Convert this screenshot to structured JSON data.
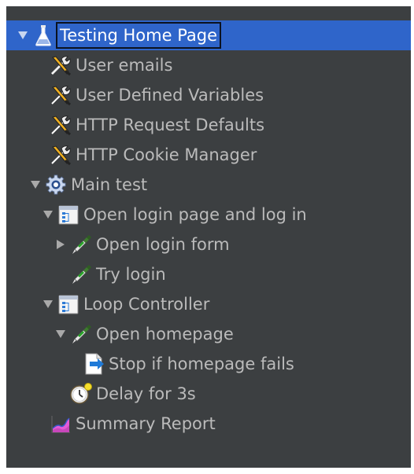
{
  "tree": {
    "items": [
      {
        "label": "Testing Home Page",
        "icon": "test-plan-icon",
        "expanded": true,
        "selected": true
      },
      {
        "label": "User emails",
        "icon": "config-element-icon"
      },
      {
        "label": "User Defined Variables",
        "icon": "config-element-icon"
      },
      {
        "label": "HTTP Request Defaults",
        "icon": "config-element-icon"
      },
      {
        "label": "HTTP Cookie Manager",
        "icon": "config-element-icon"
      },
      {
        "label": "Main test",
        "icon": "thread-group-icon",
        "expanded": true
      },
      {
        "label": "Open login page and log in",
        "icon": "controller-icon",
        "expanded": true
      },
      {
        "label": "Open login form",
        "icon": "sampler-icon",
        "expanded": false
      },
      {
        "label": "Try login",
        "icon": "sampler-icon"
      },
      {
        "label": "Loop Controller",
        "icon": "controller-icon",
        "expanded": true
      },
      {
        "label": "Open homepage",
        "icon": "sampler-icon",
        "expanded": true
      },
      {
        "label": "Stop if homepage fails",
        "icon": "assertion-icon"
      },
      {
        "label": "Delay for 3s",
        "icon": "timer-icon"
      },
      {
        "label": "Summary Report",
        "icon": "listener-icon"
      }
    ]
  },
  "colors": {
    "background": "#3c3f41",
    "selection": "#2f65ca",
    "text": "#bbbbbb",
    "selected_text": "#ffffff"
  }
}
